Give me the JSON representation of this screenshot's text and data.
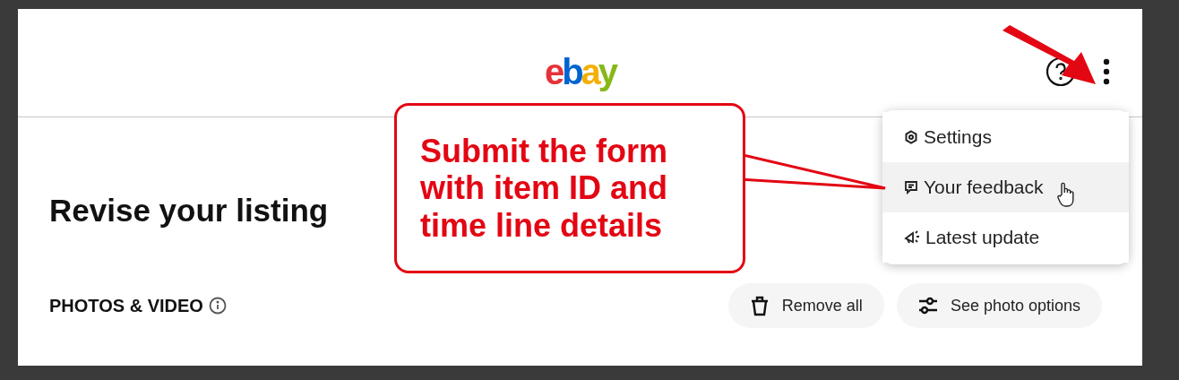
{
  "header": {
    "logo": [
      {
        "text": "e",
        "color": "#e53238"
      },
      {
        "text": "b",
        "color": "#0064d2"
      },
      {
        "text": "a",
        "color": "#f5af02"
      },
      {
        "text": "y",
        "color": "#86b817"
      }
    ]
  },
  "page_title": "Revise your listing",
  "section": {
    "title": "PHOTOS & VIDEO",
    "buttons": [
      {
        "label": "Remove all",
        "kind": "trash"
      },
      {
        "label": "See photo options",
        "kind": "sliders"
      }
    ]
  },
  "menu": {
    "items": [
      {
        "label": "Settings",
        "kind": "settings",
        "selected": false
      },
      {
        "label": "Your feedback",
        "kind": "feedback",
        "selected": true
      },
      {
        "label": "Latest update",
        "kind": "update",
        "selected": false
      }
    ]
  },
  "callout": {
    "lines": [
      "Submit the form",
      "with item ID and",
      "time line details"
    ]
  }
}
